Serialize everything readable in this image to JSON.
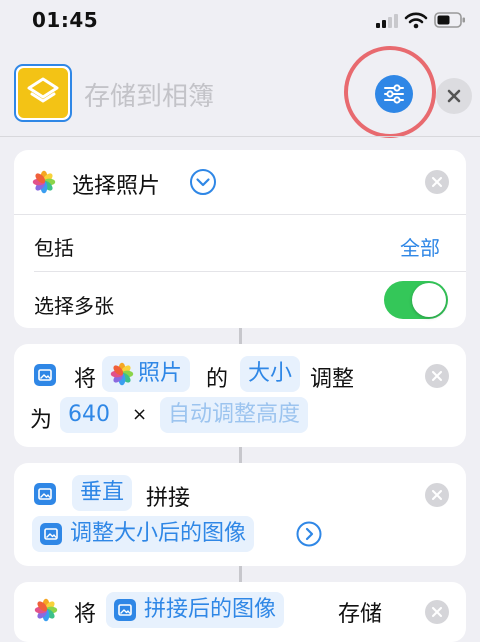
{
  "status_bar": {
    "time": "01:45"
  },
  "header": {
    "title": "存储到相簿",
    "close_glyph": "×"
  },
  "select_photos": {
    "title": "选择照片",
    "include_label": "包括",
    "include_value": "全部",
    "multi_label": "选择多张",
    "multi_enabled": true
  },
  "resize_action": {
    "word_1": "将",
    "var_photos": "照片",
    "word_2": "的",
    "param_size": "大小",
    "word_3": "调整",
    "word_4": "为",
    "width": "640",
    "times": "×",
    "height_placeholder": "自动调整高度"
  },
  "combine_action": {
    "direction": "垂直",
    "word": "拼接",
    "var_resized": "调整大小后的图像"
  },
  "save_action": {
    "word_1": "将",
    "var_combined": "拼接后的图像",
    "word_2": "存储"
  },
  "colors": {
    "accent": "#2f87e6",
    "toggle_on": "#34c759",
    "app_icon": "#f3c315",
    "highlight_ring": "#e86a6f"
  },
  "icons": {
    "shortcut_app": "shortcuts-layers-icon",
    "settings": "sliders-icon",
    "photos": "photos-flower-icon",
    "image_action": "image-icon"
  }
}
